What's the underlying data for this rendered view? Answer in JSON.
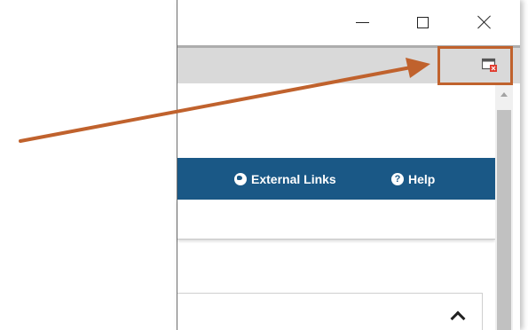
{
  "window": {
    "controls": {
      "minimize_icon": "minimize-icon",
      "maximize_icon": "maximize-icon",
      "close_icon": "close-icon"
    },
    "toolbar": {
      "popup_icon": "close-popup-window-icon",
      "popup_icon_badge_color": "#e03b2e"
    },
    "navbar": {
      "background": "#1a5886",
      "external_links": {
        "label": "External Links",
        "icon": "globe-icon"
      },
      "help": {
        "label": "Help",
        "icon": "question-circle-icon"
      }
    },
    "panel": {
      "toggle_icon": "chevron-up-icon"
    }
  },
  "annotation": {
    "color": "#c0622d",
    "arrow_icon": "pointer-arrow"
  }
}
